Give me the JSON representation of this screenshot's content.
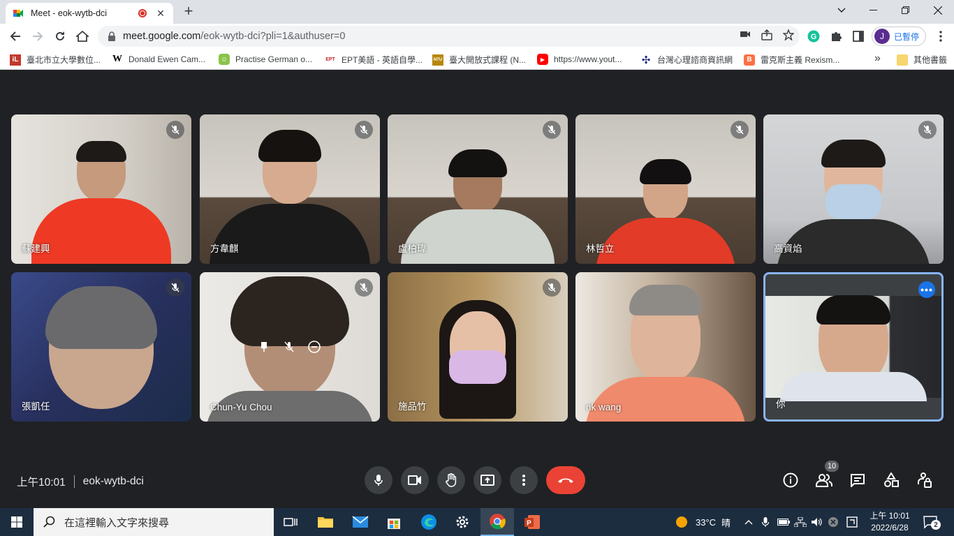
{
  "browser": {
    "tab": {
      "title": "Meet - eok-wytb-dci"
    },
    "address": {
      "host": "meet.google.com",
      "path": "/eok-wytb-dci?pli=1&authuser=0"
    },
    "profile": {
      "initial": "J",
      "label": "已暫停"
    },
    "bookmarks": [
      {
        "label": "臺北市立大學數位...",
        "icon": "iL",
        "color": "#c0392b"
      },
      {
        "label": "Donald Ewen Cam...",
        "icon": "W",
        "color": "#ffffff"
      },
      {
        "label": "Practise German o...",
        "icon": "☺",
        "color": "#8bc34a"
      },
      {
        "label": "EPT美語 - 英語自學...",
        "icon": "EPT",
        "color": "#c62828"
      },
      {
        "label": "臺大開放式課程 (N...",
        "icon": "NTU",
        "color": "#b8860b"
      },
      {
        "label": "https://www.yout...",
        "icon": "▶",
        "color": "#ff0000"
      },
      {
        "label": "台灣心理諮商資訊網",
        "icon": "✣",
        "color": "#1a237e"
      },
      {
        "label": "雷克斯主義 Rexism...",
        "icon": "B",
        "color": "#ff7043"
      }
    ],
    "other_bookmarks": "其他書籤"
  },
  "meet": {
    "time": "上午10:01",
    "code": "eok-wytb-dci",
    "participant_count": "10",
    "participants": [
      {
        "name": "蘇建興",
        "muted": true
      },
      {
        "name": "方韋麒",
        "muted": true
      },
      {
        "name": "盧柏瑋",
        "muted": true
      },
      {
        "name": "林哲立",
        "muted": true
      },
      {
        "name": "高資焰",
        "muted": true
      },
      {
        "name": "張凱任",
        "muted": true
      },
      {
        "name": "Chun-Yu Chou",
        "muted": true
      },
      {
        "name": "施品竹",
        "muted": true
      },
      {
        "name": "nk wang",
        "muted": false
      },
      {
        "name": "你",
        "muted": false,
        "is_self": true
      }
    ],
    "controls": [
      "microphone",
      "camera",
      "raise-hand",
      "present-screen",
      "more-options",
      "leave-call"
    ],
    "side_controls": [
      "meeting-details",
      "people",
      "chat",
      "activities",
      "host-controls"
    ],
    "colors": {
      "end_call": "#ea4335",
      "self_border": "#8ab4f8",
      "accent": "#1a73e8"
    }
  },
  "taskbar": {
    "search_placeholder": "在這裡輸入文字來搜尋",
    "weather": {
      "temp": "33°C",
      "condition": "晴"
    },
    "time": "上午 10:01",
    "date": "2022/6/28",
    "notifications": "2"
  }
}
